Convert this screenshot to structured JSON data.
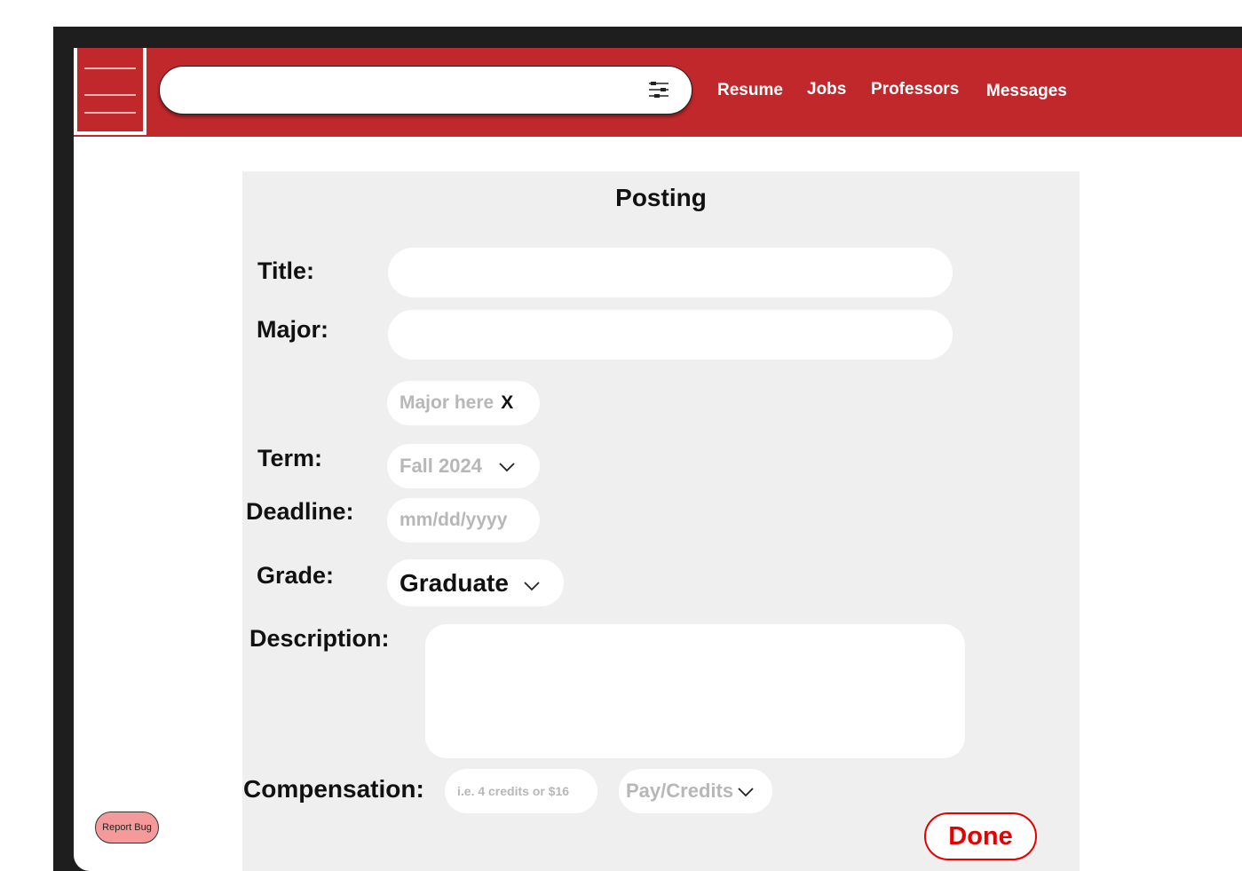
{
  "header": {
    "search": {
      "value": "",
      "placeholder": ""
    },
    "nav": [
      "Resume",
      "Jobs",
      "Professors",
      "Messages"
    ]
  },
  "form": {
    "title": "Posting",
    "labels": {
      "title": "Title:",
      "major": "Major:",
      "term": "Term:",
      "deadline": "Deadline:",
      "grade": "Grade:",
      "description": "Description:",
      "compensation": "Compensation:"
    },
    "major_tag": {
      "text": "Major here",
      "remove": "X"
    },
    "term_value": "Fall 2024",
    "deadline_placeholder": "mm/dd/yyyy",
    "grade_value": "Graduate",
    "compensation_placeholder": "i.e. 4 credits or $16",
    "compensation_type": "Pay/Credits",
    "done_label": "Done"
  },
  "footer": {
    "report_bug": "Report Bug"
  },
  "colors": {
    "brand_red": "#c1282c",
    "done_red": "#e60000",
    "report_bug_bg": "#f59a9a",
    "panel_bg": "#efefef"
  },
  "icons": {
    "menu": "hamburger-icon",
    "filter": "sliders-icon",
    "dropdown": "chevron-down-icon"
  }
}
